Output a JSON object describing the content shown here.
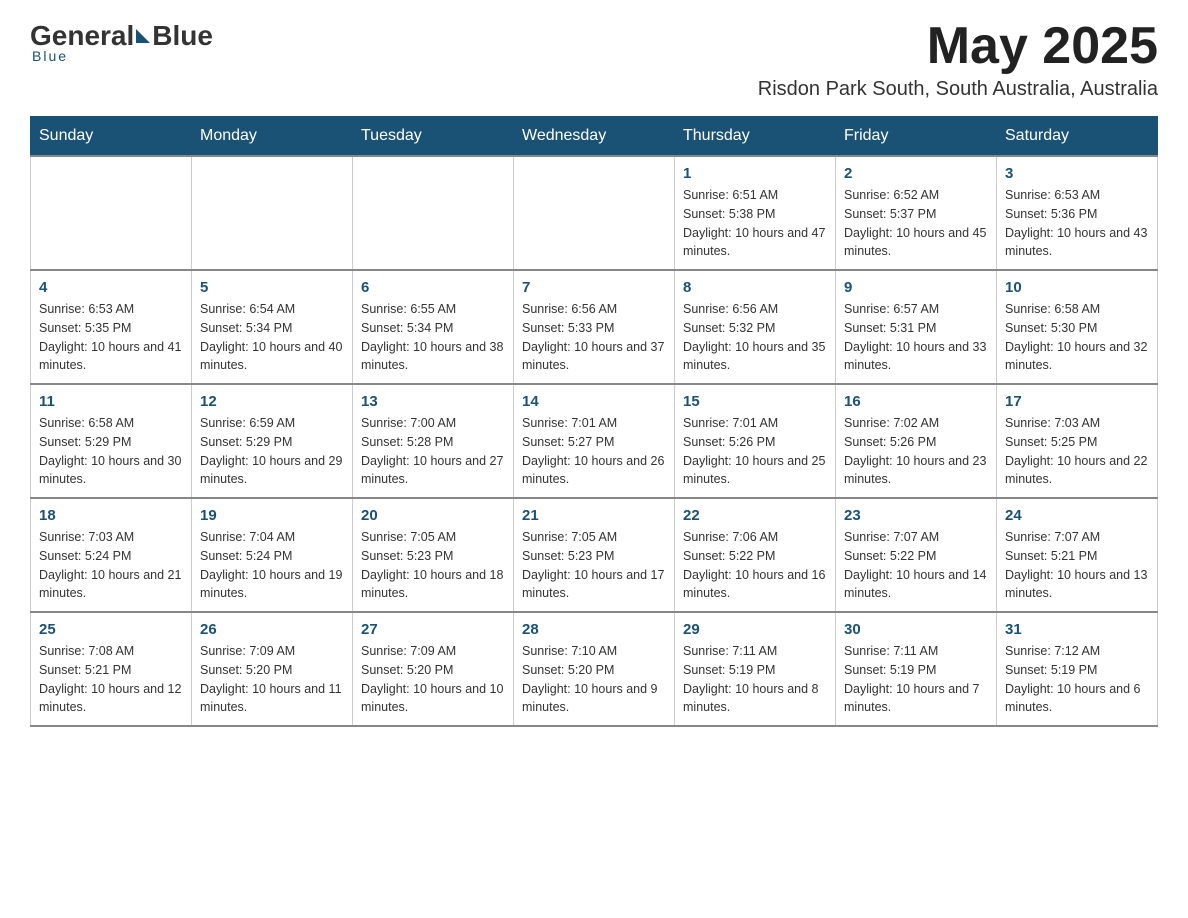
{
  "logo": {
    "general": "General",
    "blue": "Blue",
    "underline": "Blue"
  },
  "header": {
    "month_title": "May 2025",
    "location": "Risdon Park South, South Australia, Australia"
  },
  "days_of_week": [
    "Sunday",
    "Monday",
    "Tuesday",
    "Wednesday",
    "Thursday",
    "Friday",
    "Saturday"
  ],
  "weeks": [
    [
      {
        "day": "",
        "info": ""
      },
      {
        "day": "",
        "info": ""
      },
      {
        "day": "",
        "info": ""
      },
      {
        "day": "",
        "info": ""
      },
      {
        "day": "1",
        "info": "Sunrise: 6:51 AM\nSunset: 5:38 PM\nDaylight: 10 hours and 47 minutes."
      },
      {
        "day": "2",
        "info": "Sunrise: 6:52 AM\nSunset: 5:37 PM\nDaylight: 10 hours and 45 minutes."
      },
      {
        "day": "3",
        "info": "Sunrise: 6:53 AM\nSunset: 5:36 PM\nDaylight: 10 hours and 43 minutes."
      }
    ],
    [
      {
        "day": "4",
        "info": "Sunrise: 6:53 AM\nSunset: 5:35 PM\nDaylight: 10 hours and 41 minutes."
      },
      {
        "day": "5",
        "info": "Sunrise: 6:54 AM\nSunset: 5:34 PM\nDaylight: 10 hours and 40 minutes."
      },
      {
        "day": "6",
        "info": "Sunrise: 6:55 AM\nSunset: 5:34 PM\nDaylight: 10 hours and 38 minutes."
      },
      {
        "day": "7",
        "info": "Sunrise: 6:56 AM\nSunset: 5:33 PM\nDaylight: 10 hours and 37 minutes."
      },
      {
        "day": "8",
        "info": "Sunrise: 6:56 AM\nSunset: 5:32 PM\nDaylight: 10 hours and 35 minutes."
      },
      {
        "day": "9",
        "info": "Sunrise: 6:57 AM\nSunset: 5:31 PM\nDaylight: 10 hours and 33 minutes."
      },
      {
        "day": "10",
        "info": "Sunrise: 6:58 AM\nSunset: 5:30 PM\nDaylight: 10 hours and 32 minutes."
      }
    ],
    [
      {
        "day": "11",
        "info": "Sunrise: 6:58 AM\nSunset: 5:29 PM\nDaylight: 10 hours and 30 minutes."
      },
      {
        "day": "12",
        "info": "Sunrise: 6:59 AM\nSunset: 5:29 PM\nDaylight: 10 hours and 29 minutes."
      },
      {
        "day": "13",
        "info": "Sunrise: 7:00 AM\nSunset: 5:28 PM\nDaylight: 10 hours and 27 minutes."
      },
      {
        "day": "14",
        "info": "Sunrise: 7:01 AM\nSunset: 5:27 PM\nDaylight: 10 hours and 26 minutes."
      },
      {
        "day": "15",
        "info": "Sunrise: 7:01 AM\nSunset: 5:26 PM\nDaylight: 10 hours and 25 minutes."
      },
      {
        "day": "16",
        "info": "Sunrise: 7:02 AM\nSunset: 5:26 PM\nDaylight: 10 hours and 23 minutes."
      },
      {
        "day": "17",
        "info": "Sunrise: 7:03 AM\nSunset: 5:25 PM\nDaylight: 10 hours and 22 minutes."
      }
    ],
    [
      {
        "day": "18",
        "info": "Sunrise: 7:03 AM\nSunset: 5:24 PM\nDaylight: 10 hours and 21 minutes."
      },
      {
        "day": "19",
        "info": "Sunrise: 7:04 AM\nSunset: 5:24 PM\nDaylight: 10 hours and 19 minutes."
      },
      {
        "day": "20",
        "info": "Sunrise: 7:05 AM\nSunset: 5:23 PM\nDaylight: 10 hours and 18 minutes."
      },
      {
        "day": "21",
        "info": "Sunrise: 7:05 AM\nSunset: 5:23 PM\nDaylight: 10 hours and 17 minutes."
      },
      {
        "day": "22",
        "info": "Sunrise: 7:06 AM\nSunset: 5:22 PM\nDaylight: 10 hours and 16 minutes."
      },
      {
        "day": "23",
        "info": "Sunrise: 7:07 AM\nSunset: 5:22 PM\nDaylight: 10 hours and 14 minutes."
      },
      {
        "day": "24",
        "info": "Sunrise: 7:07 AM\nSunset: 5:21 PM\nDaylight: 10 hours and 13 minutes."
      }
    ],
    [
      {
        "day": "25",
        "info": "Sunrise: 7:08 AM\nSunset: 5:21 PM\nDaylight: 10 hours and 12 minutes."
      },
      {
        "day": "26",
        "info": "Sunrise: 7:09 AM\nSunset: 5:20 PM\nDaylight: 10 hours and 11 minutes."
      },
      {
        "day": "27",
        "info": "Sunrise: 7:09 AM\nSunset: 5:20 PM\nDaylight: 10 hours and 10 minutes."
      },
      {
        "day": "28",
        "info": "Sunrise: 7:10 AM\nSunset: 5:20 PM\nDaylight: 10 hours and 9 minutes."
      },
      {
        "day": "29",
        "info": "Sunrise: 7:11 AM\nSunset: 5:19 PM\nDaylight: 10 hours and 8 minutes."
      },
      {
        "day": "30",
        "info": "Sunrise: 7:11 AM\nSunset: 5:19 PM\nDaylight: 10 hours and 7 minutes."
      },
      {
        "day": "31",
        "info": "Sunrise: 7:12 AM\nSunset: 5:19 PM\nDaylight: 10 hours and 6 minutes."
      }
    ]
  ]
}
